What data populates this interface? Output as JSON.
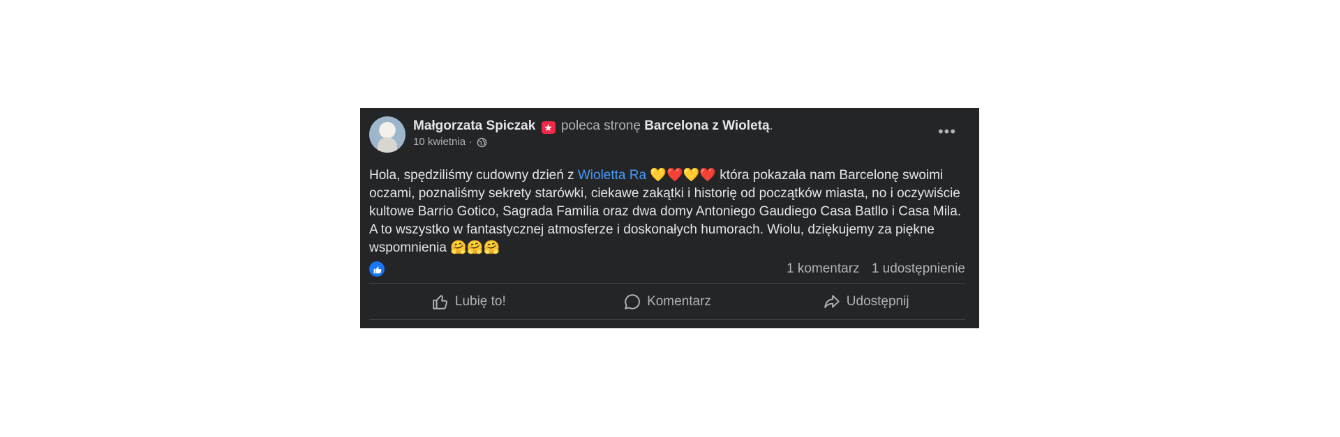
{
  "post": {
    "author": "Małgorzata Spiczak",
    "recommend_icon": "recommend-star-icon",
    "verb": " poleca stronę ",
    "page_name": "Barcelona z Wioletą",
    "page_suffix": ".",
    "date": "10 kwietnia",
    "separator": " · ",
    "privacy_icon": "globe-icon",
    "more_icon": "more-options-icon",
    "text_before": "Hola, spędziliśmy cudowny dzień z ",
    "mention": "Wioletta Ra",
    "hearts": " 💛❤️💛❤️ ",
    "text_after": "która pokazała nam Barcelonę swoimi oczami, poznaliśmy sekrety starówki, ciekawe zakątki i historię od początków miasta, no i oczywiście kultowe Barrio Gotico, Sagrada Familia oraz dwa domy Antoniego Gaudiego Casa Batllo i Casa Mila. A to wszystko w fantastycznej atmosferze i doskonałych humorach. Wiolu, dziękujemy za piękne wspomnienia ",
    "hug_emojis": "🤗🤗🤗",
    "accent_color": "#4599ff"
  },
  "stats": {
    "reaction_icon": "like-reaction-icon",
    "comments": "1 komentarz",
    "shares": "1 udostępnienie"
  },
  "actions": {
    "like_label": "Lubię to!",
    "comment_label": "Komentarz",
    "share_label": "Udostępnij"
  }
}
